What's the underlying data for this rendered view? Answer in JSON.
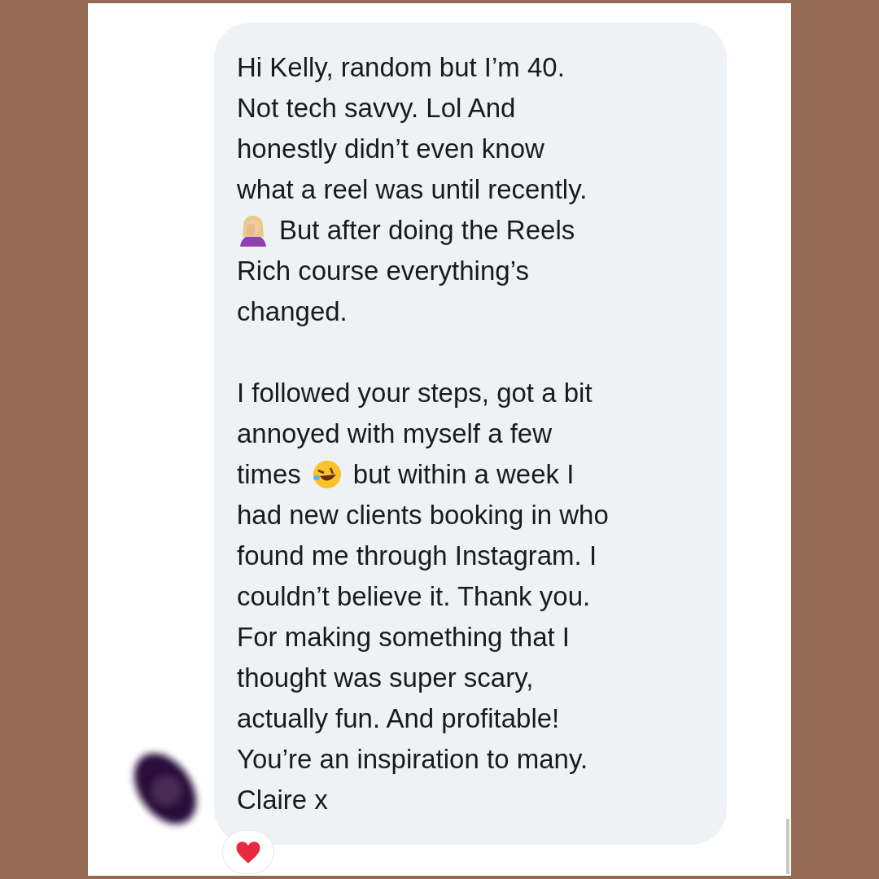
{
  "message": {
    "paragraphs": [
      {
        "lines": [
          {
            "segments": [
              {
                "kind": "text",
                "text": "Hi Kelly, random but I’m 40."
              }
            ]
          },
          {
            "segments": [
              {
                "kind": "text",
                "text": "Not tech savvy. Lol And"
              }
            ]
          },
          {
            "segments": [
              {
                "kind": "text",
                "text": "honestly didn’t even know"
              }
            ]
          },
          {
            "segments": [
              {
                "kind": "text",
                "text": "what a reel was until recently."
              }
            ]
          },
          {
            "segments": [
              {
                "kind": "figure-emoji"
              },
              {
                "kind": "text",
                "text": "But after doing the Reels"
              }
            ]
          },
          {
            "segments": [
              {
                "kind": "text",
                "text": "Rich course everything’s"
              }
            ]
          },
          {
            "segments": [
              {
                "kind": "text",
                "text": "changed."
              }
            ]
          }
        ]
      },
      {
        "lines": [
          {
            "segments": [
              {
                "kind": "text",
                "text": "I followed your steps, got a bit"
              }
            ]
          },
          {
            "segments": [
              {
                "kind": "text",
                "text": "annoyed with myself a few"
              }
            ]
          },
          {
            "segments": [
              {
                "kind": "text",
                "text": "times"
              },
              {
                "kind": "face-emoji"
              },
              {
                "kind": "text",
                "text": "but within a week I"
              }
            ]
          },
          {
            "segments": [
              {
                "kind": "text",
                "text": "had new clients booking in who"
              }
            ]
          },
          {
            "segments": [
              {
                "kind": "text",
                "text": "found me through Instagram. I"
              }
            ]
          },
          {
            "segments": [
              {
                "kind": "text",
                "text": "couldn’t believe it. Thank you."
              }
            ]
          },
          {
            "segments": [
              {
                "kind": "text",
                "text": "For making something that I"
              }
            ]
          },
          {
            "segments": [
              {
                "kind": "text",
                "text": "thought was super scary,"
              }
            ]
          },
          {
            "segments": [
              {
                "kind": "text",
                "text": "actually fun. And profitable!"
              }
            ]
          },
          {
            "segments": [
              {
                "kind": "text",
                "text": "You’re an inspiration to many."
              }
            ]
          },
          {
            "segments": [
              {
                "kind": "text",
                "text": "Claire x"
              }
            ]
          }
        ]
      }
    ],
    "reaction": {
      "kind": "heart"
    }
  }
}
